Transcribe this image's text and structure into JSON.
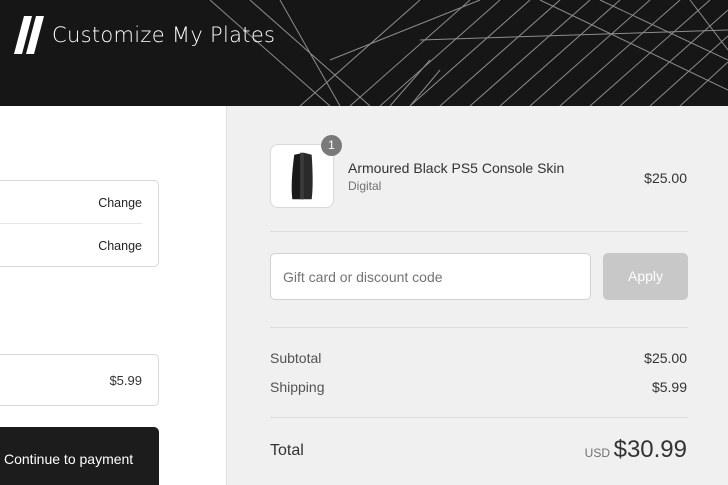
{
  "header": {
    "brand_name": "Customize My Plates",
    "logo_icon": "double-slash-logo",
    "background_color": "#161616"
  },
  "left": {
    "review": [
      {
        "action_label": "Change"
      },
      {
        "action_label": "Change"
      }
    ],
    "shipping_method": {
      "price": "$5.99"
    },
    "continue_button": {
      "label": "Continue to payment"
    }
  },
  "summary": {
    "item": {
      "quantity": "1",
      "name": "Armoured Black PS5 Console Skin",
      "variant": "Digital",
      "price": "$25.00",
      "image_icon": "ps5-console-icon"
    },
    "discount": {
      "placeholder": "Gift card or discount code",
      "value": "",
      "apply_label": "Apply"
    },
    "subtotal": {
      "label": "Subtotal",
      "value": "$25.00"
    },
    "shipping": {
      "label": "Shipping",
      "value": "$5.99"
    },
    "total": {
      "label": "Total",
      "currency": "USD",
      "value": "$30.99"
    }
  },
  "colors": {
    "button_dark": "#1c1c1c",
    "apply_disabled": "#c8c8c8",
    "summary_bg": "#f0f0f0",
    "badge": "#7a7a7a"
  }
}
